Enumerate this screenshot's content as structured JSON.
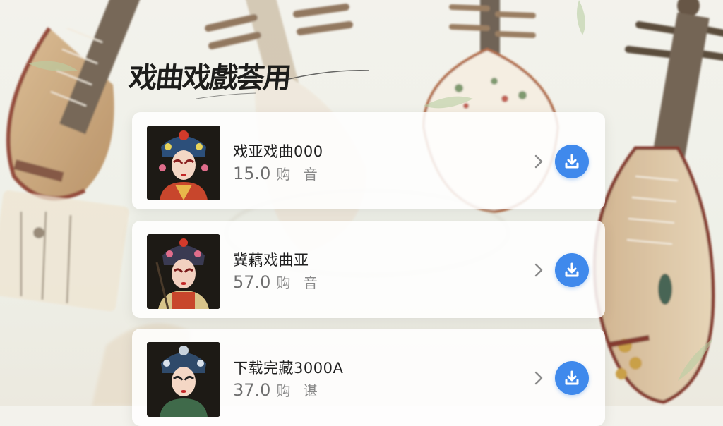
{
  "app": {
    "title": "戏曲戏戲荟用"
  },
  "colors": {
    "accent": "#3f89ec",
    "card_bg": "#ffffff",
    "title": "#1d1d1b"
  },
  "items": [
    {
      "name": "戏亚戏曲000",
      "size": "15.0",
      "unit": "购 音",
      "action_icon": "download-icon"
    },
    {
      "name": "冀藕戏曲亚",
      "size": "57.0",
      "unit": "购 音",
      "action_icon": "download-icon"
    },
    {
      "name": "下载完藏3000A",
      "size": "37.0",
      "unit": "购 谌",
      "action_icon": "download-icon"
    }
  ]
}
